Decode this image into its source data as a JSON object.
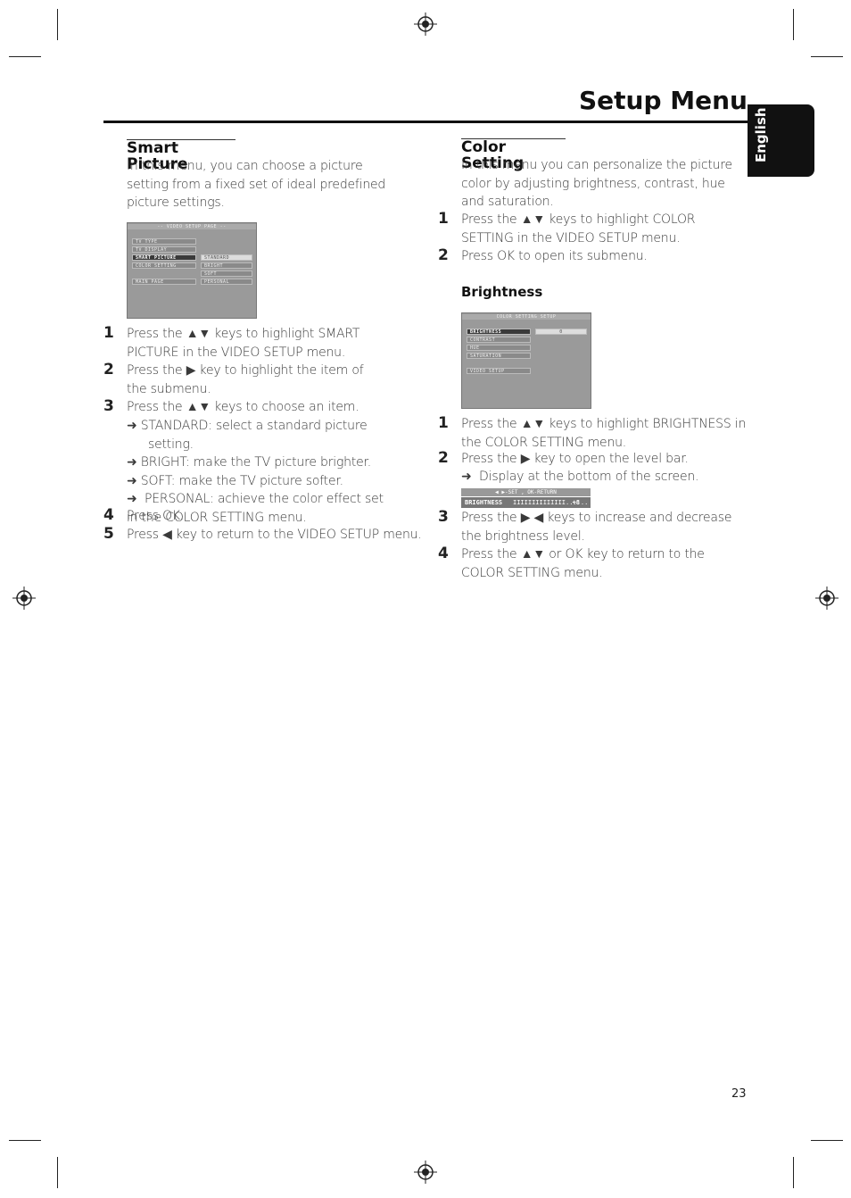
{
  "header": {
    "title": "Setup Menu",
    "language_tab": "English"
  },
  "left": {
    "heading": "Smart Picture",
    "intro": "In this menu, you can choose a picture setting from a fixed set of ideal predefined picture settings.",
    "screen": {
      "title": "-- VIDEO SETUP PAGE --",
      "items": [
        "TV TYPE",
        "TV DISPLAY",
        "SMART PICTURE",
        "COLOR SETTING",
        "MAIN PAGE"
      ],
      "options": [
        "STANDARD",
        "BRIGHT",
        "SOFT",
        "PERSONAL"
      ]
    },
    "steps": [
      {
        "n": "1",
        "text": "Press the ▲▼ keys to highlight SMART PICTURE in the VIDEO SETUP menu."
      },
      {
        "n": "2",
        "text": "Press the ▶ key to highlight the item of the submenu."
      },
      {
        "n": "3",
        "text": "Press the ▲▼ keys to choose an item."
      },
      {
        "n": "4",
        "text": "Press OK."
      },
      {
        "n": "5",
        "text": "Press ◀ key to return to the VIDEO SETUP menu."
      }
    ],
    "bullets": [
      "STANDARD: select a standard picture setting.",
      "BRIGHT: make the TV picture brighter.",
      "SOFT: make the TV picture softer.",
      "PERSONAL: achieve the color effect set in the COLOR  SETTING menu."
    ],
    "arrow": "➜"
  },
  "right": {
    "heading": "Color Setting",
    "intro": "In this menu you can personalize the picture color by adjusting brightness, contrast, hue and saturation.",
    "steps": [
      {
        "n": "1",
        "text": "Press the ▲▼ keys to highlight COLOR SETTING in the VIDEO SETUP menu."
      },
      {
        "n": "2",
        "text": "Press OK to open its submenu."
      }
    ],
    "subheading": "Brightness",
    "screen": {
      "title": "COLOR SETTING SETUP",
      "items": [
        "BRIGHTNESS",
        "CONTRAST",
        "HUE",
        "SATURATION",
        "VIDEO SETUP"
      ],
      "value": "0"
    },
    "bright_steps": [
      {
        "n": "1",
        "text": "Press the ▲▼ keys to highlight BRIGHTNESS in the COLOR SETTING menu."
      },
      {
        "n": "2",
        "text": "Press the ▶ key to open the level bar."
      },
      {
        "n": "3",
        "text": "Press the ▶ ◀ keys to increase and decrease the brightness level."
      },
      {
        "n": "4",
        "text": "Press the ▲▼ or OK key to return to the COLOR SETTING menu."
      }
    ],
    "bullet": "Display at the bottom of the screen.",
    "levelbar": {
      "hint": "◀ ▶-SET , OK-RETURN",
      "label": "BRIGHTNESS",
      "bars": "IIIIIIIIIIIIII......",
      "value": "+8"
    }
  },
  "footer": {
    "page_number": "23"
  }
}
